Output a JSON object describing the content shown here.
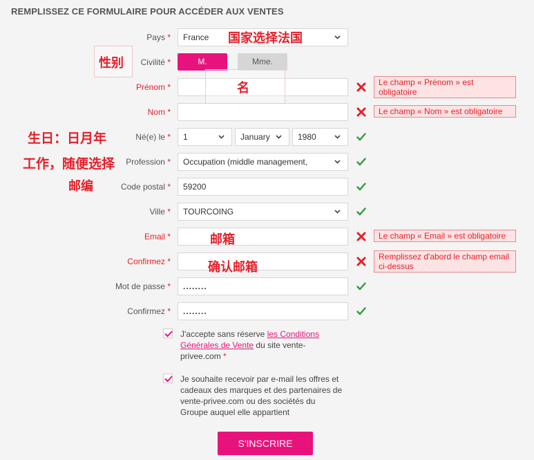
{
  "page": {
    "title": "REMPLISSEZ CE FORMULAIRE POUR ACCÉDER AUX VENTES"
  },
  "colors": {
    "accent": "#e8127c",
    "error": "#e5202b",
    "ok": "#2e9b3a"
  },
  "form": {
    "required_mark": "*",
    "country": {
      "label": "Pays",
      "value": "France"
    },
    "civility": {
      "label": "Civilité",
      "option_male": "M.",
      "option_female": "Mme."
    },
    "firstname": {
      "label": "Prénom",
      "value": "",
      "error": "Le champ « Prénom » est obligatoire"
    },
    "lastname": {
      "label": "Nom",
      "value": "",
      "error": "Le champ « Nom » est obligatoire"
    },
    "birthdate": {
      "label": "Né(e) le",
      "day": "1",
      "month": "January",
      "year": "1980"
    },
    "profession": {
      "label": "Profession",
      "value": "Occupation (middle management,"
    },
    "postal_code": {
      "label": "Code postal",
      "value": "59200"
    },
    "city": {
      "label": "Ville",
      "value": "TOURCOING"
    },
    "email": {
      "label": "Email",
      "value": "",
      "error": "Le champ « Email » est obligatoire"
    },
    "email_confirm": {
      "label": "Confirmez",
      "value": "",
      "error": "Remplissez d'abord le champ email ci-dessus"
    },
    "password": {
      "label": "Mot de passe",
      "value": "........"
    },
    "password_confirm": {
      "label": "Confirmez",
      "value": "........"
    },
    "terms": {
      "text_before": "J'accepte sans réserve ",
      "link": "les Conditions Générales de Vente",
      "text_after": " du site vente-privee.com"
    },
    "newsletter": {
      "text": "Je souhaite recevoir par e-mail les offres et cadeaux des marques et des partenaires de vente-privee.com ou des sociétés du Groupe auquel elle appartient"
    },
    "submit_label": "S'INSCRIRE"
  },
  "annotations": {
    "country_note": "国家选择法国",
    "gender_note": "性别",
    "firstname_note": "名",
    "birthday_note": "生日：日月年",
    "job_note": "工作，随便选择",
    "postcode_note": "邮编",
    "email_note": "邮箱",
    "confirm_email_note": "确认邮箱"
  }
}
